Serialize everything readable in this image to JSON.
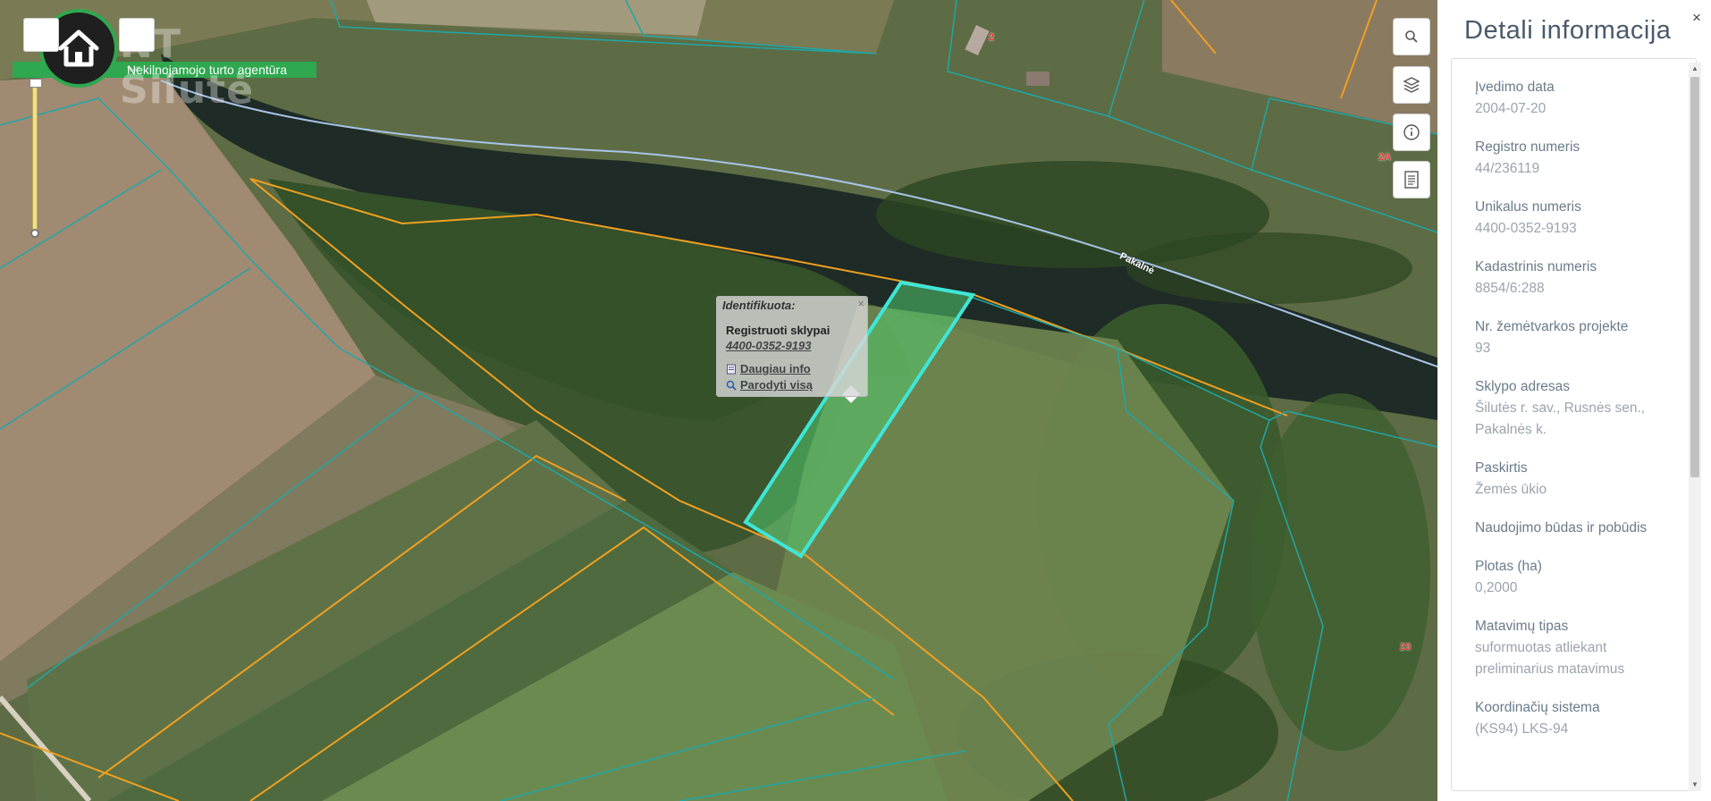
{
  "logo": {
    "title": "NT Šilutė",
    "subtitle": "Nekilnojamojo turto agentūra",
    "icon": "house-icon"
  },
  "map": {
    "road_label": "Pakalnė",
    "labels": [
      "2",
      "2A",
      "23"
    ]
  },
  "popup": {
    "title": "Identifikuota:",
    "close": "×",
    "heading": "Registruoti sklypai",
    "parcel_number": "4400-0352-9193",
    "more_info": "Daugiau info",
    "show_all": "Parodyti visą"
  },
  "map_buttons": [
    "search-icon",
    "layers-icon",
    "info-icon",
    "document-icon"
  ],
  "panel": {
    "title": "Detali informacija",
    "close": "×",
    "fields": [
      {
        "label": "Įvedimo data",
        "value": "2004-07-20"
      },
      {
        "label": "Registro numeris",
        "value": "44/236119"
      },
      {
        "label": "Unikalus numeris",
        "value": "4400-0352-9193"
      },
      {
        "label": "Kadastrinis numeris",
        "value": "8854/6:288"
      },
      {
        "label": "Nr. žemėtvarkos projekte",
        "value": "93"
      },
      {
        "label": "Sklypo adresas",
        "value": "Šilutės r. sav., Rusnės sen., Pakalnės k."
      },
      {
        "label": "Paskirtis",
        "value": "Žemės ūkio"
      },
      {
        "label": "Naudojimo būdas ir pobūdis",
        "value": ""
      },
      {
        "label": "Plotas (ha)",
        "value": "0,2000"
      },
      {
        "label": "Matavimų tipas",
        "value": "suformuotas atliekant preliminarius matavimus"
      },
      {
        "label": "Koordinačių sistema",
        "value": "(KS94) LKS-94"
      }
    ]
  },
  "colors": {
    "accent_green": "#2fa84f",
    "parcel_highlight": "#3ee6d8",
    "boundary_orange": "#f0a020",
    "boundary_teal": "#1fa7a7"
  }
}
